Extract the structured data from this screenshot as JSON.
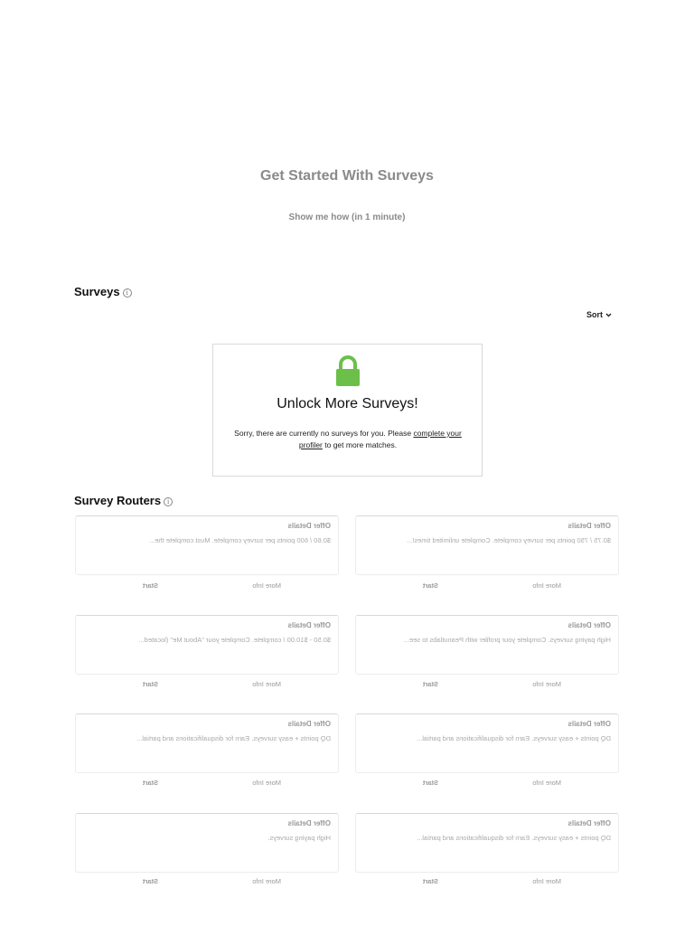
{
  "hero": {
    "title": "Get Started With Surveys",
    "link": "Show me how (in 1 minute)"
  },
  "surveys": {
    "title": "Surveys",
    "info_icon": "info-icon",
    "sort_label": "Sort",
    "sort_icon": "chevron-down-icon"
  },
  "unlock": {
    "icon": "lock-icon",
    "icon_color": "#6cc04a",
    "title": "Unlock More Surveys!",
    "text_before": "Sorry, there are currently no surveys for you. Please ",
    "link_text": "complete your profiler",
    "text_after": " to get more matches."
  },
  "routers": {
    "title": "Survey Routers",
    "info_icon": "info-icon",
    "cards": [
      {
        "title": "Offer Details",
        "desc": "$0.60 / 600 points per survey complete. Must complete the...",
        "more": "More Info",
        "start": "Start"
      },
      {
        "title": "Offer Details",
        "desc": "$0.75 / 750 points per survey complete. Complete unlimited times!...",
        "more": "More Info",
        "start": "Start"
      },
      {
        "title": "Offer Details",
        "desc": "$0.50 - $10.00 / complete. Complete your \"About Me\" (located...",
        "more": "More Info",
        "start": "Start"
      },
      {
        "title": "Offer Details",
        "desc": "High paying surveys. Complete your profiler with Peanutlabs to see...",
        "more": "More Info",
        "start": "Start"
      },
      {
        "title": "Offer Details",
        "desc": "DQ points + easy surveys. Earn for disqualifications and partial...",
        "more": "More Info",
        "start": "Start"
      },
      {
        "title": "Offer Details",
        "desc": "DQ points + easy surveys. Earn for disqualifications and partial...",
        "more": "More Info",
        "start": "Start"
      },
      {
        "title": "Offer Details",
        "desc": "High paying surveys.",
        "more": "More Info",
        "start": "Start"
      },
      {
        "title": "Offer Details",
        "desc": "DQ points + easy surveys. Earn for disqualifications and partial...",
        "more": "More Info",
        "start": "Start"
      }
    ]
  }
}
